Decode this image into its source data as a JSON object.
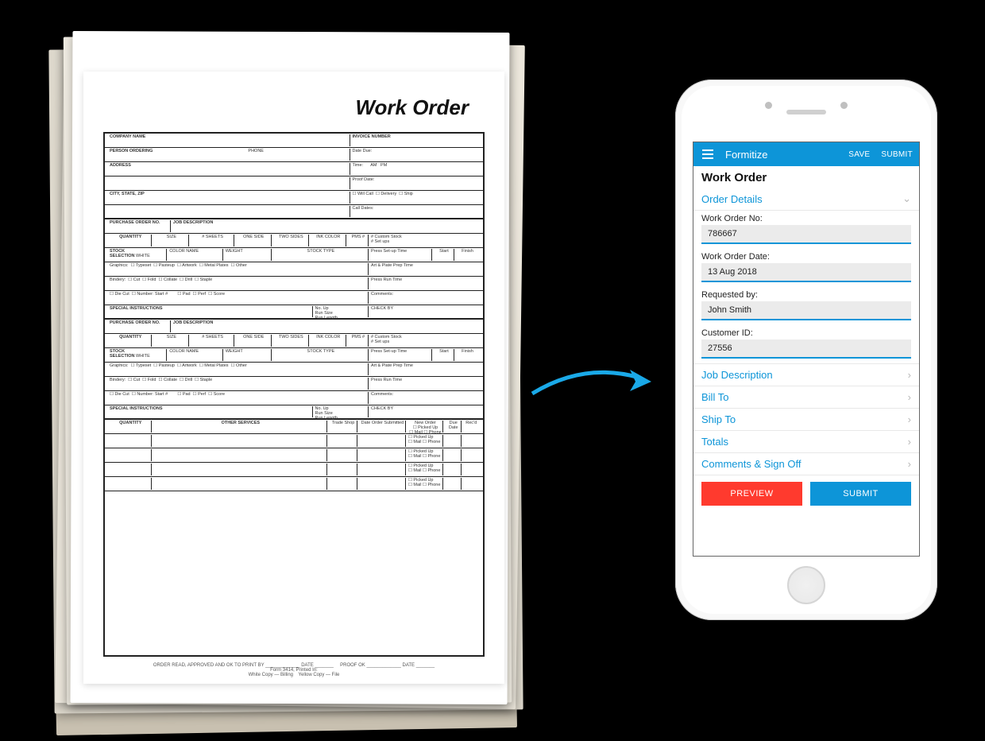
{
  "paper": {
    "title": "Work Order"
  },
  "app": {
    "brand": "Formitize",
    "save": "SAVE",
    "submit": "SUBMIT"
  },
  "form": {
    "title": "Work Order",
    "section_order_details": "Order Details",
    "fields": {
      "work_order_no": {
        "label": "Work Order No:",
        "value": "786667"
      },
      "work_order_date": {
        "label": "Work Order Date:",
        "value": "13 Aug 2018"
      },
      "requested_by": {
        "label": "Requested by:",
        "value": "John Smith"
      },
      "customer_id": {
        "label": "Customer ID:",
        "value": "27556"
      }
    },
    "sections": {
      "job_description": "Job Description",
      "bill_to": "Bill To",
      "ship_to": "Ship To",
      "totals": "Totals",
      "comments": "Comments & Sign Off"
    },
    "buttons": {
      "preview": "PREVIEW",
      "submit": "SUBMIT"
    }
  }
}
